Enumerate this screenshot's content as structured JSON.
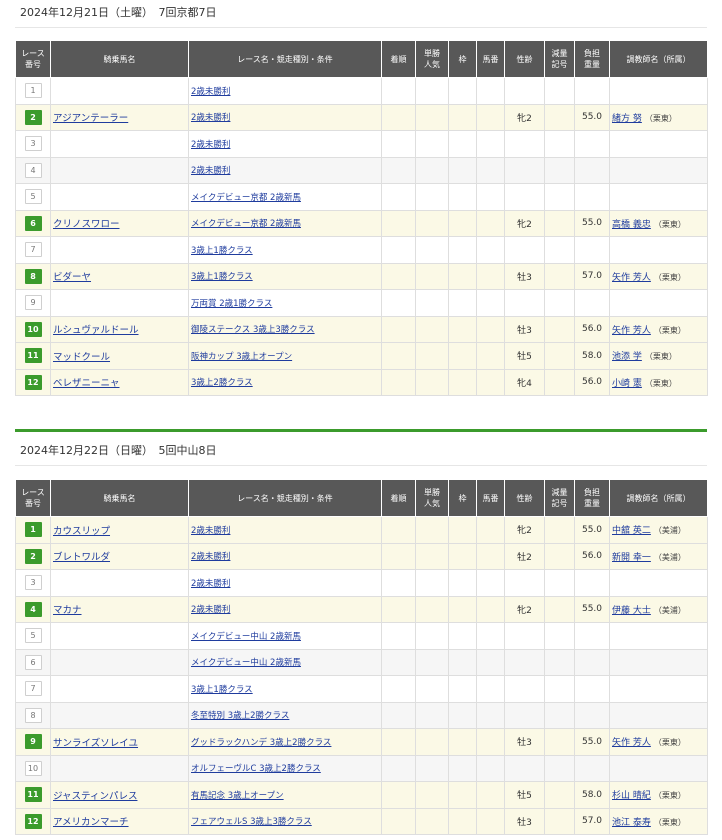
{
  "headers": [
    "レース\n番号",
    "騎乗馬名",
    "レース名・競走種別・条件",
    "着順",
    "単勝\n人気",
    "枠",
    "馬番",
    "性齢",
    "減量\n記号",
    "負担\n重量",
    "調教師名（所属）"
  ],
  "days": [
    {
      "title": "2024年12月21日（土曜）　7回京都7日",
      "rows": [
        {
          "no": "1",
          "horse": "",
          "race": "2歳未勝利",
          "sexage": "",
          "weight": "",
          "trainer": "",
          "stable": ""
        },
        {
          "no": "2",
          "horse": "アジアンテーラー",
          "race": "2歳未勝利",
          "sexage": "牝2",
          "weight": "55.0",
          "trainer": "緒方 努",
          "stable": "（栗東）"
        },
        {
          "no": "3",
          "horse": "",
          "race": "2歳未勝利",
          "sexage": "",
          "weight": "",
          "trainer": "",
          "stable": ""
        },
        {
          "no": "4",
          "horse": "",
          "race": "2歳未勝利",
          "sexage": "",
          "weight": "",
          "trainer": "",
          "stable": ""
        },
        {
          "no": "5",
          "horse": "",
          "race": "メイクデビュー京都 2歳新馬",
          "sexage": "",
          "weight": "",
          "trainer": "",
          "stable": ""
        },
        {
          "no": "6",
          "horse": "クリノスワロー",
          "race": "メイクデビュー京都 2歳新馬",
          "sexage": "牝2",
          "weight": "55.0",
          "trainer": "高橋 義忠",
          "stable": "（栗東）"
        },
        {
          "no": "7",
          "horse": "",
          "race": "3歳上1勝クラス",
          "sexage": "",
          "weight": "",
          "trainer": "",
          "stable": ""
        },
        {
          "no": "8",
          "horse": "ビダーヤ",
          "race": "3歳上1勝クラス",
          "sexage": "牡3",
          "weight": "57.0",
          "trainer": "矢作 芳人",
          "stable": "（栗東）"
        },
        {
          "no": "9",
          "horse": "",
          "race": "万両賞 2歳1勝クラス",
          "sexage": "",
          "weight": "",
          "trainer": "",
          "stable": ""
        },
        {
          "no": "10",
          "horse": "ルシュヴァルドール",
          "race": "御陵ステークス 3歳上3勝クラス",
          "sexage": "牡3",
          "weight": "56.0",
          "trainer": "矢作 芳人",
          "stable": "（栗東）"
        },
        {
          "no": "11",
          "horse": "マッドクール",
          "race": "阪神カップ 3歳上オープン",
          "sexage": "牡5",
          "weight": "58.0",
          "trainer": "池添 学",
          "stable": "（栗東）"
        },
        {
          "no": "12",
          "horse": "ベレザニーニャ",
          "race": "3歳上2勝クラス",
          "sexage": "牝4",
          "weight": "56.0",
          "trainer": "小崎 憲",
          "stable": "（栗東）"
        }
      ]
    },
    {
      "title": "2024年12月22日（日曜）　5回中山8日",
      "rows": [
        {
          "no": "1",
          "horse": "カウスリップ",
          "race": "2歳未勝利",
          "sexage": "牝2",
          "weight": "55.0",
          "trainer": "中舘 英二",
          "stable": "（美浦）"
        },
        {
          "no": "2",
          "horse": "ブレトワルダ",
          "race": "2歳未勝利",
          "sexage": "牡2",
          "weight": "56.0",
          "trainer": "新開 幸一",
          "stable": "（美浦）"
        },
        {
          "no": "3",
          "horse": "",
          "race": "2歳未勝利",
          "sexage": "",
          "weight": "",
          "trainer": "",
          "stable": ""
        },
        {
          "no": "4",
          "horse": "マカナ",
          "race": "2歳未勝利",
          "sexage": "牝2",
          "weight": "55.0",
          "trainer": "伊藤 大士",
          "stable": "（美浦）"
        },
        {
          "no": "5",
          "horse": "",
          "race": "メイクデビュー中山 2歳新馬",
          "sexage": "",
          "weight": "",
          "trainer": "",
          "stable": ""
        },
        {
          "no": "6",
          "horse": "",
          "race": "メイクデビュー中山 2歳新馬",
          "sexage": "",
          "weight": "",
          "trainer": "",
          "stable": ""
        },
        {
          "no": "7",
          "horse": "",
          "race": "3歳上1勝クラス",
          "sexage": "",
          "weight": "",
          "trainer": "",
          "stable": ""
        },
        {
          "no": "8",
          "horse": "",
          "race": "冬至特別 3歳上2勝クラス",
          "sexage": "",
          "weight": "",
          "trainer": "",
          "stable": ""
        },
        {
          "no": "9",
          "horse": "サンライズソレイユ",
          "race": "グッドラックハンデ 3歳上2勝クラス",
          "sexage": "牡3",
          "weight": "55.0",
          "trainer": "矢作 芳人",
          "stable": "（栗東）"
        },
        {
          "no": "10",
          "horse": "",
          "race": "オルフェーヴルC 3歳上2勝クラス",
          "sexage": "",
          "weight": "",
          "trainer": "",
          "stable": ""
        },
        {
          "no": "11",
          "horse": "ジャスティンパレス",
          "race": "有馬記念 3歳上オープン",
          "sexage": "牡5",
          "weight": "58.0",
          "trainer": "杉山 晴紀",
          "stable": "（栗東）"
        },
        {
          "no": "12",
          "horse": "アメリカンマーチ",
          "race": "フェアウェルS 3歳上3勝クラス",
          "sexage": "牡3",
          "weight": "57.0",
          "trainer": "池江 泰寿",
          "stable": "（栗東）"
        }
      ]
    }
  ],
  "colors": {
    "accent": "#3b9b2c",
    "header_bg": "#585858",
    "ride_row": "#fbf9e6",
    "link": "#1f3c9e"
  }
}
